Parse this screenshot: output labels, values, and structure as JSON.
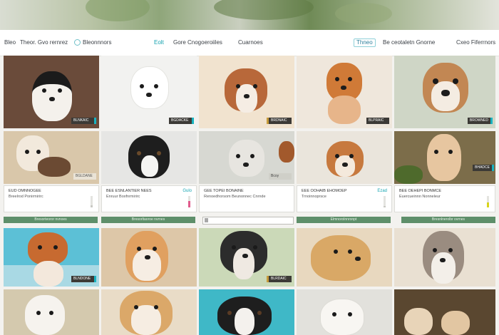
{
  "nav": {
    "items": [
      "Bleo",
      "Theor. Gvo rernrez",
      "Bleonnnors",
      "Eolt",
      "Gore Cnogoeroiiles",
      "Cuarnoes",
      "Thneo",
      "Be ceotaletn Gnorne",
      "Cxeo Fiferrnors"
    ]
  },
  "badges": [
    "BLNKAIC",
    "BGDACKE",
    "BRDNAIC",
    "BLPRAIC",
    "BROWNED",
    "BGLDANE",
    "Bcoy",
    "BHADCE",
    "BLNDONE",
    "BLRDAIC"
  ],
  "cards": [
    {
      "title": "EUD OMNNOGEE",
      "sub": "Breelrod Ponirmirirc",
      "tag": "",
      "bar_fill": 0.2,
      "bar_color": "#c9c9c4"
    },
    {
      "title": "BEE ESNLANTIER NEES",
      "sub": "Enruur Boxfnrmirirc",
      "tag": "Gulo",
      "bar_fill": 0.55,
      "bar_color": "#e05a8c"
    },
    {
      "title": "GEE TOPEI BONAINE",
      "sub": "Renoedhorsom Beunonnec Cnrnde",
      "tag": "",
      "bar_fill": 0.0,
      "bar_color": "#c9c9c4"
    },
    {
      "title": "EEE OOHAIB EHOMOEP",
      "sub": "Trnoinnoprsce",
      "tag": "Ezad",
      "bar_fill": 0.15,
      "bar_color": "#c9c9c4"
    },
    {
      "title": "BEE OEHEPI BONMCE",
      "sub": "Euercueinnn Nonneleur",
      "tag": "",
      "bar_fill": 0.45,
      "bar_color": "#d8d41c"
    }
  ],
  "buttons": [
    "Bresorteoror nvnoes",
    "Bresorltaoroe nvrnes",
    "Elmnorolnnronpt",
    "Bresnlnerolbr ovrnes"
  ],
  "search": {
    "placeholder": ""
  }
}
